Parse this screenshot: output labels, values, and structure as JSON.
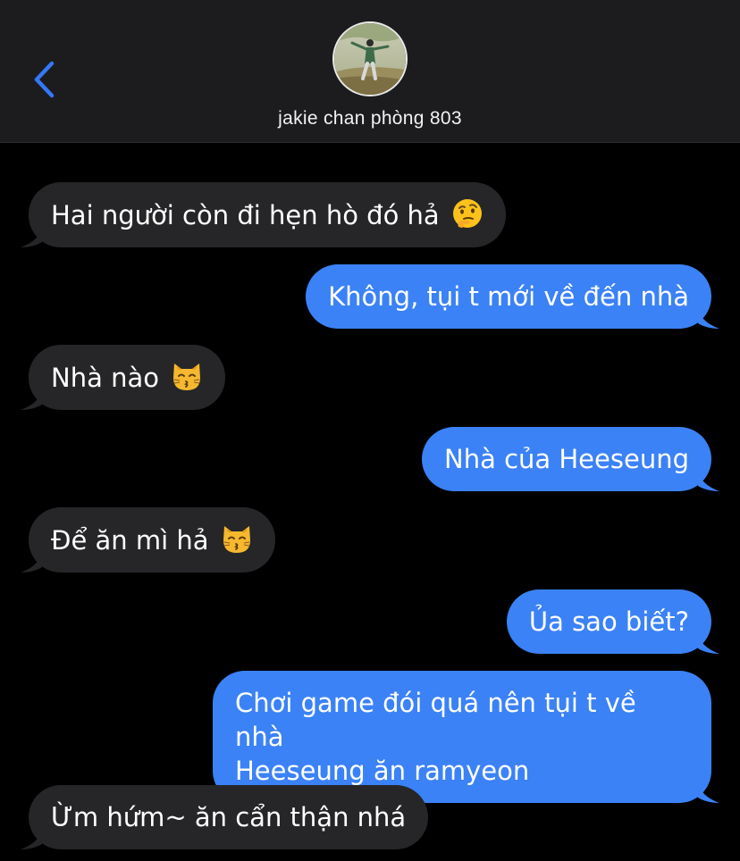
{
  "header": {
    "contact_name": "jakie chan phòng 803",
    "back_icon": "chevron-left-icon",
    "accent": "#3478f6"
  },
  "messages": [
    {
      "side": "received",
      "text": "Hai người còn đi hẹn hò đó hả",
      "emoji": "thinking-face"
    },
    {
      "side": "sent",
      "text": "Không, tụi t mới về đến nhà"
    },
    {
      "side": "received",
      "text": "Nhà nào",
      "emoji": "kissing-cat-face"
    },
    {
      "side": "sent",
      "text": "Nhà của Heeseung"
    },
    {
      "side": "received",
      "text": "Để ăn mì hả",
      "emoji": "kissing-cat-face"
    },
    {
      "side": "sent",
      "text": "Ủa sao biết?"
    },
    {
      "side": "sent",
      "lines": [
        "Chơi game đói quá nên tụi t về nhà",
        "Heeseung ăn ramyeon"
      ]
    },
    {
      "side": "received",
      "text": "Ừm hứm~ ăn cẩn thận nhá"
    }
  ],
  "colors": {
    "received_bubble": "#262628",
    "sent_bubble": "#3b82f6",
    "background": "#000000",
    "header_bg": "#1c1c1e"
  }
}
